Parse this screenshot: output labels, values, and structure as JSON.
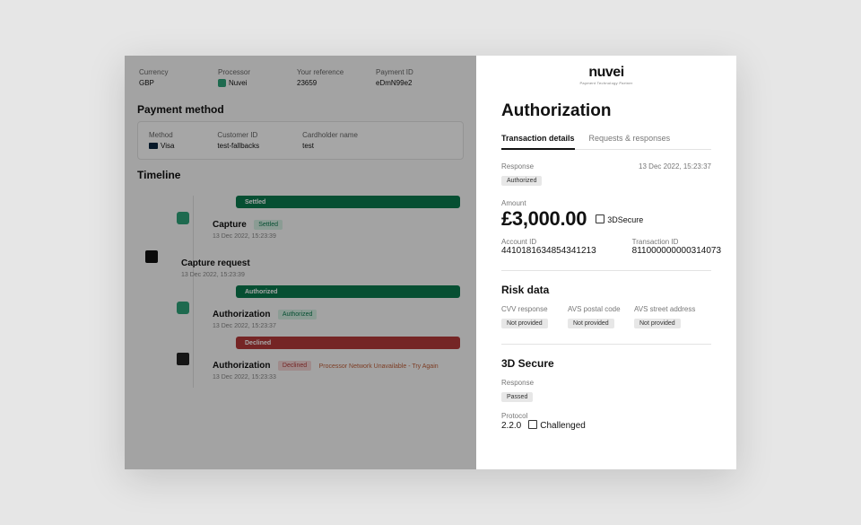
{
  "summary": {
    "currency_lbl": "Currency",
    "currency": "GBP",
    "processor_lbl": "Processor",
    "processor": "Nuvei",
    "ref_lbl": "Your reference",
    "ref": "23659",
    "pid_lbl": "Payment ID",
    "pid": "eDmN99e2"
  },
  "payment_method": {
    "title": "Payment method",
    "method_lbl": "Method",
    "method": "Visa",
    "customer_lbl": "Customer ID",
    "customer": "test-fallbacks",
    "cardholder_lbl": "Cardholder name",
    "cardholder": "test"
  },
  "timeline": {
    "title": "Timeline",
    "bar_settled": "Settled",
    "bar_authorized": "Authorized",
    "bar_declined": "Declined",
    "events": [
      {
        "title": "Capture",
        "tag": "Settled",
        "tag_color": "green",
        "ts": "13 Dec 2022, 15:23:39",
        "icon": "proc"
      },
      {
        "title": "Capture request",
        "ts": "13 Dec 2022, 15:23:39",
        "icon": "dark",
        "inset": true
      },
      {
        "title": "Authorization",
        "tag": "Authorized",
        "tag_color": "green",
        "ts": "13 Dec 2022, 15:23:37",
        "icon": "proc"
      },
      {
        "title": "Authorization",
        "tag": "Declined",
        "tag_color": "red",
        "ts": "13 Dec 2022, 15:23:33",
        "note": "Processor Network Unavailable - Try Again",
        "icon": "dark2"
      }
    ]
  },
  "panel": {
    "logo": "nuvei",
    "logo_sub": "Payment Technology Partner",
    "title": "Authorization",
    "tabs": [
      "Transaction details",
      "Requests & responses"
    ],
    "response_lbl": "Response",
    "response_chip": "Authorized",
    "response_ts": "13 Dec 2022, 15:23:37",
    "amount_lbl": "Amount",
    "amount": "£3,000.00",
    "secure_tag": "3DSecure",
    "account_lbl": "Account ID",
    "account": "4410181634854341213",
    "txn_lbl": "Transaction ID",
    "txn": "811000000000314073",
    "risk_title": "Risk data",
    "risk": [
      {
        "lbl": "CVV response",
        "val": "Not provided"
      },
      {
        "lbl": "AVS postal code",
        "val": "Not provided"
      },
      {
        "lbl": "AVS street address",
        "val": "Not provided"
      }
    ],
    "tds_title": "3D Secure",
    "tds_response_lbl": "Response",
    "tds_response": "Passed",
    "tds_proto_lbl": "Protocol",
    "tds_proto": "2.2.0",
    "tds_flag": "Challenged"
  }
}
